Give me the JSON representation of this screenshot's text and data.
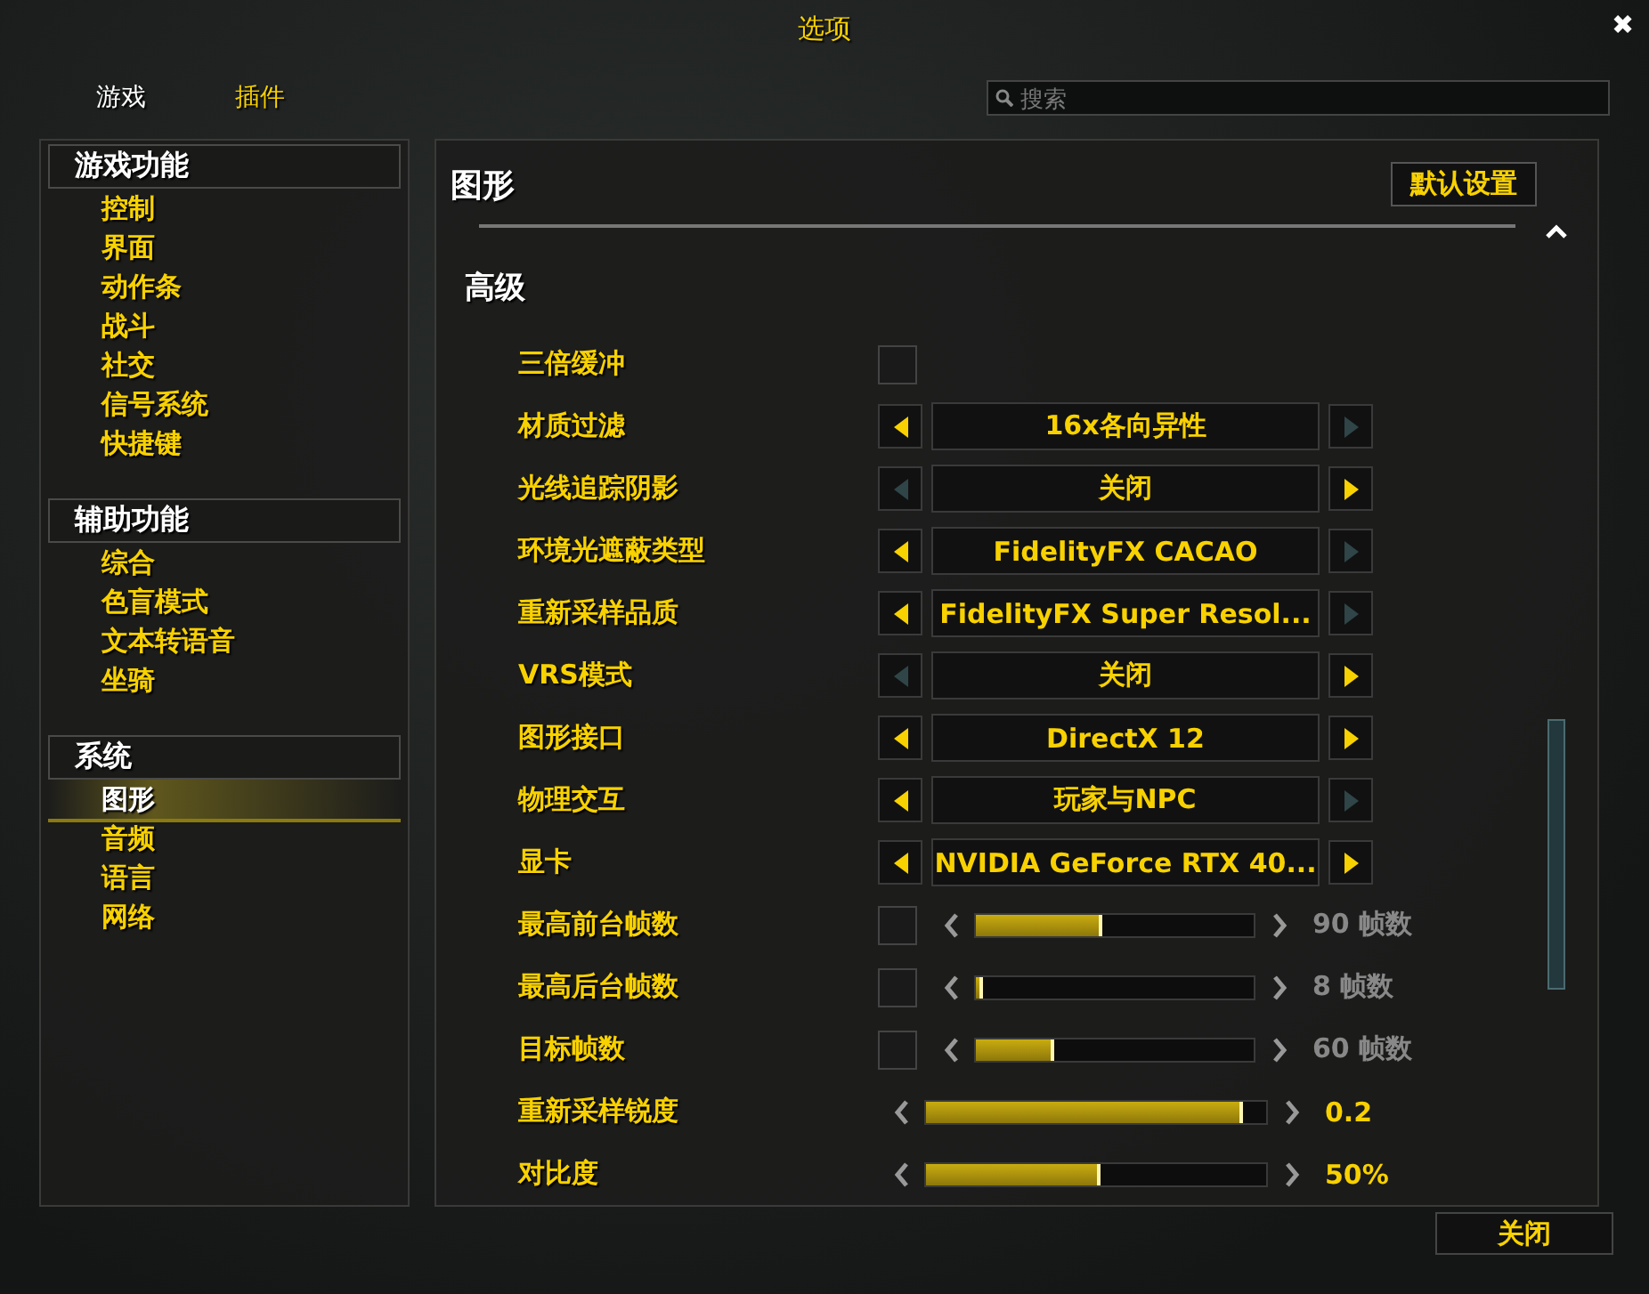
{
  "window": {
    "title": "选项",
    "close": "✖"
  },
  "tabs": [
    {
      "label": "游戏",
      "selected": true
    },
    {
      "label": "插件",
      "selected": false
    }
  ],
  "search": {
    "placeholder": "搜索"
  },
  "sidebar": [
    {
      "title": "游戏功能",
      "items": [
        {
          "label": "控制",
          "selected": false
        },
        {
          "label": "界面",
          "selected": false
        },
        {
          "label": "动作条",
          "selected": false
        },
        {
          "label": "战斗",
          "selected": false
        },
        {
          "label": "社交",
          "selected": false
        },
        {
          "label": "信号系统",
          "selected": false
        },
        {
          "label": "快捷键",
          "selected": false
        }
      ]
    },
    {
      "title": "辅助功能",
      "items": [
        {
          "label": "综合",
          "selected": false
        },
        {
          "label": "色盲模式",
          "selected": false
        },
        {
          "label": "文本转语音",
          "selected": false
        },
        {
          "label": "坐骑",
          "selected": false
        }
      ]
    },
    {
      "title": "系统",
      "items": [
        {
          "label": "图形",
          "selected": true
        },
        {
          "label": "音频",
          "selected": false
        },
        {
          "label": "语言",
          "selected": false
        },
        {
          "label": "网络",
          "selected": false
        }
      ]
    }
  ],
  "panel": {
    "title": "图形",
    "default_button": "默认设置",
    "section": "高级",
    "settings": [
      {
        "kind": "checkbox",
        "label": "三倍缓冲",
        "checked": false
      },
      {
        "kind": "dropdown",
        "label": "材质过滤",
        "value": "16x各向异性",
        "prev_enabled": true,
        "next_enabled": false
      },
      {
        "kind": "dropdown",
        "label": "光线追踪阴影",
        "value": "关闭",
        "prev_enabled": false,
        "next_enabled": true
      },
      {
        "kind": "dropdown",
        "label": "环境光遮蔽类型",
        "value": "FidelityFX CACAO",
        "prev_enabled": true,
        "next_enabled": false
      },
      {
        "kind": "dropdown",
        "label": "重新采样品质",
        "value": "FidelityFX Super Resol...",
        "prev_enabled": true,
        "next_enabled": false
      },
      {
        "kind": "dropdown",
        "label": "VRS模式",
        "value": "关闭",
        "prev_enabled": false,
        "next_enabled": true
      },
      {
        "kind": "dropdown",
        "label": "图形接口",
        "value": "DirectX 12",
        "prev_enabled": true,
        "next_enabled": true
      },
      {
        "kind": "dropdown",
        "label": "物理交互",
        "value": "玩家与NPC",
        "prev_enabled": true,
        "next_enabled": false
      },
      {
        "kind": "dropdown",
        "label": "显卡",
        "value": "NVIDIA GeForce RTX 40...",
        "prev_enabled": true,
        "next_enabled": true
      },
      {
        "kind": "slider",
        "label": "最高前台帧数",
        "checked": false,
        "level": 0.44,
        "reading": "90 帧数"
      },
      {
        "kind": "slider",
        "label": "最高后台帧数",
        "checked": false,
        "level": 0.01,
        "reading": "8 帧数"
      },
      {
        "kind": "slider",
        "label": "目标帧数",
        "checked": false,
        "level": 0.27,
        "reading": "60 帧数"
      },
      {
        "kind": "slider",
        "label": "重新采样锐度",
        "level": 0.92,
        "reading": "0.2"
      },
      {
        "kind": "slider",
        "label": "对比度",
        "level": 0.5,
        "reading": "50%"
      }
    ]
  },
  "close_button": "关闭"
}
